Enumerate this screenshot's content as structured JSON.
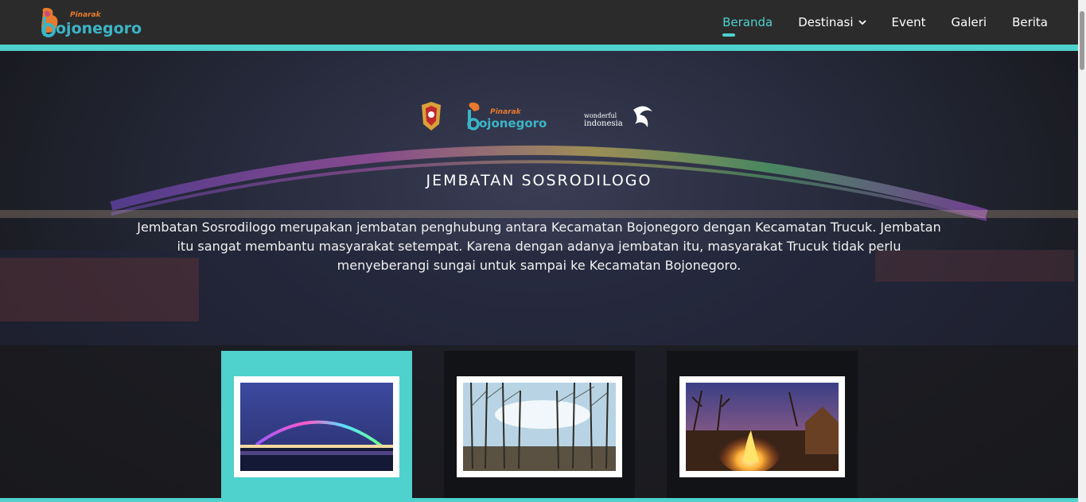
{
  "header": {
    "brand_logo_text": "Pinarak Bojonegoro",
    "nav": [
      {
        "label": "Beranda",
        "active": true
      },
      {
        "label": "Destinasi",
        "dropdown": true
      },
      {
        "label": "Event"
      },
      {
        "label": "Galeri"
      },
      {
        "label": "Berita"
      }
    ]
  },
  "hero": {
    "partner_logos": [
      "Bojonegoro regency crest",
      "Pinarak Bojonegoro",
      "wonderful indonesia"
    ],
    "title": "JEMBATAN SOSRODILOGO",
    "description": "Jembatan Sosrodilogo merupakan jembatan penghubung antara Kecamatan Bojonegoro dengan Kecamatan Trucuk. Jembatan itu sangat membantu masyarakat setempat. Karena dengan adanya jembatan itu, masyarakat Trucuk tidak perlu menyeberangi sungai untuk sampai ke Kecamatan Bojonegoro."
  },
  "cards": [
    {
      "image": "bridge-night-photo",
      "active": true
    },
    {
      "image": "teak-forest-photo",
      "active": false
    },
    {
      "image": "campfire-photo",
      "active": false
    }
  ],
  "colors": {
    "accent": "#4fd1cd",
    "header_bg": "#2b2b2b"
  }
}
